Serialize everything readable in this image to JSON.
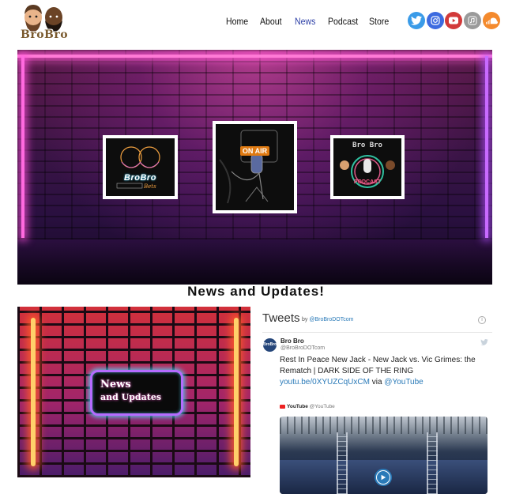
{
  "brand": {
    "logo_text": "BroBro"
  },
  "nav": {
    "items": [
      {
        "label": "Home",
        "active": false
      },
      {
        "label": "About",
        "active": false
      },
      {
        "label": "News",
        "active": true
      },
      {
        "label": "Podcast",
        "active": false
      },
      {
        "label": "Store",
        "active": false
      }
    ],
    "active_color": "#2c3fa6"
  },
  "social": [
    {
      "icon": "twitter-icon",
      "color": "#3a9be8"
    },
    {
      "icon": "instagram-icon",
      "color": "#3d6be0"
    },
    {
      "icon": "youtube-icon",
      "color": "#d23a3a"
    },
    {
      "icon": "apple-podcasts-icon",
      "color": "#9a9a9a"
    },
    {
      "icon": "soundcloud-icon",
      "color": "#f48a2d"
    }
  ],
  "hero": {
    "frame1_text": "BroBro",
    "frame2_text": "ON AIR",
    "frame3_text": "Bro  Bro",
    "frame3_label": "PODCAST"
  },
  "section_title": "News and Updates!",
  "news_image": {
    "line1": "News",
    "line2": "and Updates"
  },
  "tweets": {
    "title": "Tweets",
    "by_prefix": "by",
    "by_handle": "@BroBroDOTcom",
    "tweet": {
      "name": "Bro Bro",
      "handle": "@BroBroDOTcom",
      "text": "Rest In Peace New Jack - New Jack vs. Vic Grimes: the Rematch | DARK SIDE OF THE RING",
      "link": "youtu.be/0XYUZCqUxCM",
      "via": "via",
      "via_handle": "@YouTube"
    },
    "card": {
      "source": "YouTube",
      "source_handle": "@YouTube"
    }
  }
}
